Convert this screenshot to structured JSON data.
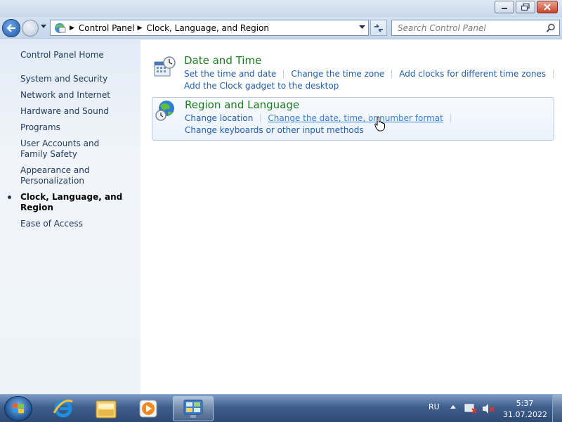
{
  "window": {
    "minimize_icon": "minimize-icon",
    "maximize_icon": "maximize-icon",
    "close_icon": "close-icon"
  },
  "navbar": {
    "back_icon": "back-arrow-icon",
    "forward_icon": "forward-arrow-icon",
    "breadcrumb": [
      "Control Panel",
      "Clock, Language, and Region"
    ],
    "refresh_icon": "refresh-icon",
    "search_placeholder": "Search Control Panel",
    "search_icon": "search-icon"
  },
  "sidebar": {
    "home": "Control Panel Home",
    "items": [
      {
        "label": "System and Security"
      },
      {
        "label": "Network and Internet"
      },
      {
        "label": "Hardware and Sound"
      },
      {
        "label": "Programs"
      },
      {
        "label": "User Accounts and Family Safety"
      },
      {
        "label": "Appearance and Personalization"
      },
      {
        "label": "Clock, Language, and Region",
        "active": true
      },
      {
        "label": "Ease of Access"
      }
    ]
  },
  "main": {
    "date_time": {
      "title": "Date and Time",
      "icon": "calendar-clock-icon",
      "links": [
        "Set the time and date",
        "Change the time zone",
        "Add clocks for different time zones",
        "Add the Clock gadget to the desktop"
      ]
    },
    "region_language": {
      "title": "Region and Language",
      "icon": "globe-clock-icon",
      "links": [
        "Change location",
        "Change the date, time, or number format",
        "Change keyboards or other input methods"
      ]
    }
  },
  "taskbar": {
    "start_icon": "windows-logo-icon",
    "pinned": [
      "internet-explorer-icon",
      "windows-explorer-icon",
      "media-player-icon",
      "control-panel-icon"
    ],
    "tray": {
      "language": "RU",
      "time": "5:37",
      "date": "31.07.2022"
    }
  },
  "colors": {
    "link": "#1f5eb4",
    "category_title": "#1e7a1e",
    "sidebar_text": "#1e395b"
  }
}
